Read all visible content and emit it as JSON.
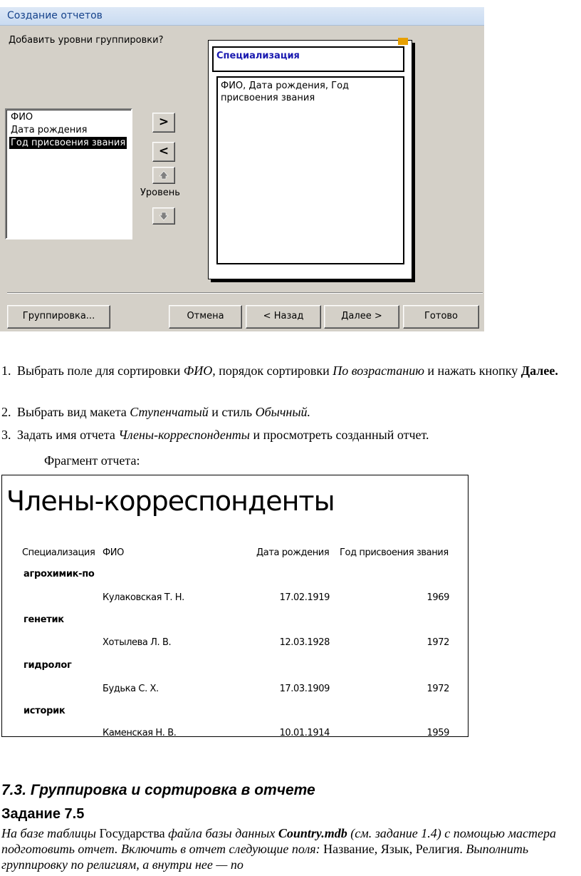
{
  "dialog": {
    "title": "Создание отчетов",
    "prompt": "Добавить уровни группировки?",
    "fields": [
      "ФИО",
      "Дата рождения",
      "Год присвоения звания"
    ],
    "selected_field_index": 2,
    "btn_add": ">",
    "btn_remove": "<",
    "level_label": "Уровень",
    "preview_group": "Специализация",
    "preview_fields": "ФИО, Дата рождения, Год присвоения звания",
    "btn_grouping": "Группировка...",
    "btn_cancel": "Отмена",
    "btn_back": "< Назад",
    "btn_next": "Далее >",
    "btn_finish": "Готово"
  },
  "steps": [
    {
      "num": "1.",
      "p1": "Выбрать поле для сортировки ",
      "i1": "ФИО,",
      "p2": " порядок сортировки ",
      "i2": "По возрастанию",
      "p3": " и нажать кнопку ",
      "b1": "Далее."
    },
    {
      "num": "2.",
      "p1": "Выбрать вид макета ",
      "i1": "Ступенчатый",
      "p2": " и стиль ",
      "i2": "Обычный."
    },
    {
      "num": "3.",
      "p1": "Задать имя отчета ",
      "i1": "Члены-корреспонденты",
      "p2": " и просмотреть созданный отчет."
    }
  ],
  "fragment_label": "Фрагмент отчета:",
  "report": {
    "title": "Члены-корреспонденты",
    "headers": [
      "Специализация",
      "ФИО",
      "Дата рождения",
      "Год присвоения звания"
    ],
    "groups": [
      {
        "name": "агрохимик-по",
        "fio": "Кулаковская Т. Н.",
        "date": "17.02.1919",
        "year": "1969"
      },
      {
        "name": "генетик",
        "fio": "Хотылева Л. В.",
        "date": "12.03.1928",
        "year": "1972"
      },
      {
        "name": "гидролог",
        "fio": "Будька С. Х.",
        "date": "17.03.1909",
        "year": "1972"
      },
      {
        "name": "историк",
        "fio": "Каменская Н. В.",
        "date": "10.01.1914",
        "year": "1959"
      }
    ]
  },
  "section_title": "7.3. Группировка и сортировка в отчете",
  "task_title": "Задание 7.5",
  "task": {
    "t1": "На базе таблицы ",
    "t2": "Государства",
    "t3": " файла базы данных ",
    "t4": "Country.mdb",
    "t5": " (см. задание 1.4) с помощью мастера подготовить отчет. Включить в отчет следующие поля: ",
    "t6": "Название, Язык, Религия.",
    "t7": " Выполнить группировку по религиям, а внутри нее — по"
  }
}
